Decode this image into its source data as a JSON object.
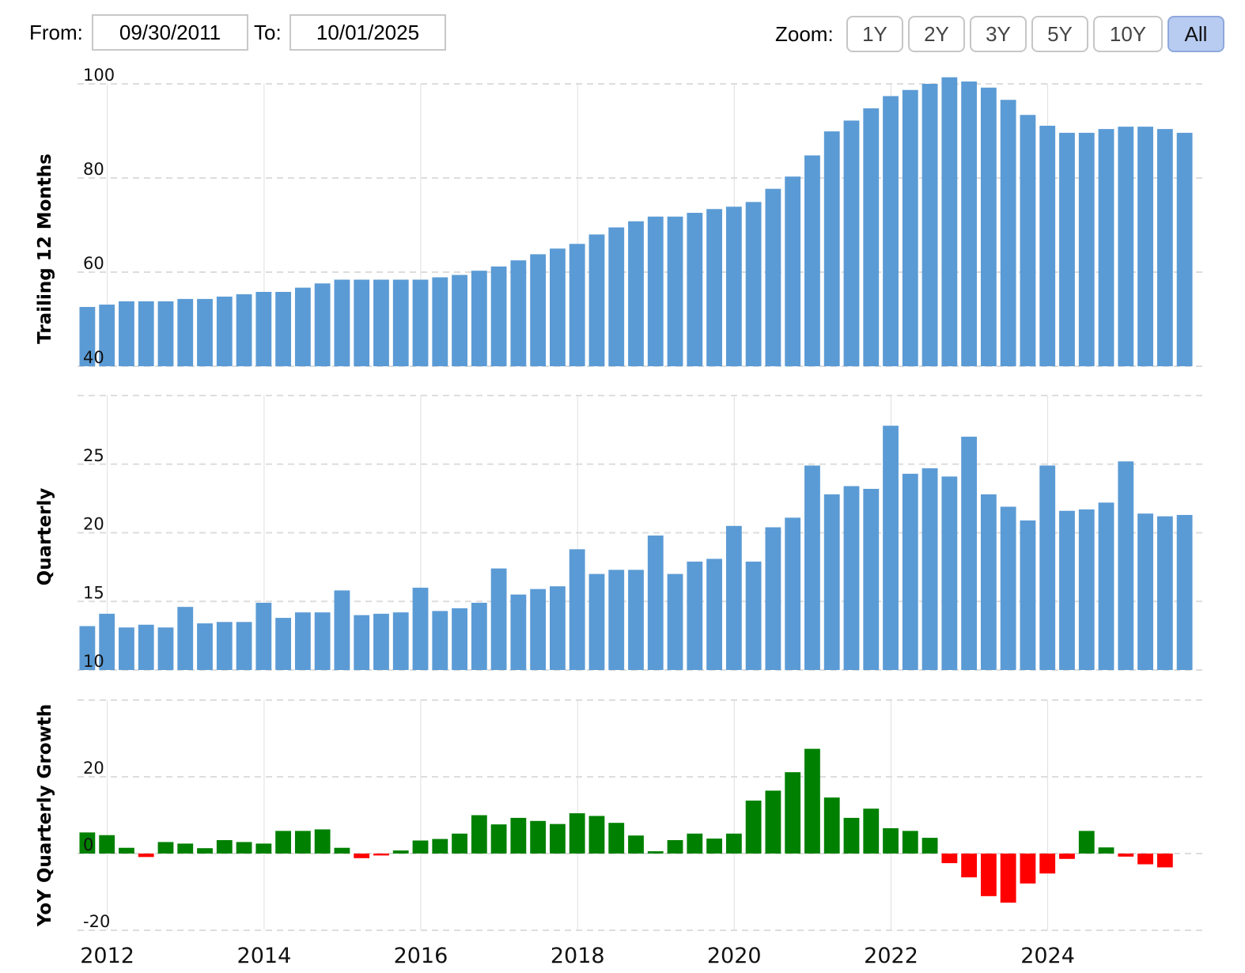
{
  "toolbar": {
    "from_label": "From:",
    "from_value": "09/30/2011",
    "to_label": "To:",
    "to_value": "10/01/2025",
    "zoom_label": "Zoom:",
    "zoom_options": [
      "1Y",
      "2Y",
      "3Y",
      "5Y",
      "10Y",
      "All"
    ],
    "zoom_active": "All"
  },
  "colors": {
    "bar": "#5b9bd5",
    "positive": "#008000",
    "negative": "#ff0000",
    "gridline": "#dddddd"
  },
  "chart_data": [
    {
      "type": "bar",
      "ylabel": "Trailing 12 Months",
      "ylim": [
        40,
        100
      ],
      "yticks": [
        40,
        60,
        80,
        100
      ],
      "x_tick_labels": [
        "2012",
        "2014",
        "2016",
        "2018",
        "2020",
        "2022",
        "2024"
      ],
      "x": [
        "2011-09-30",
        "2011-12-31",
        "2012-03-31",
        "2012-06-30",
        "2012-09-30",
        "2012-12-31",
        "2013-03-31",
        "2013-06-30",
        "2013-09-30",
        "2013-12-31",
        "2014-03-31",
        "2014-06-30",
        "2014-09-30",
        "2014-12-31",
        "2015-03-31",
        "2015-06-30",
        "2015-09-30",
        "2015-12-31",
        "2016-03-31",
        "2016-06-30",
        "2016-09-30",
        "2016-12-31",
        "2017-03-31",
        "2017-06-30",
        "2017-09-30",
        "2017-12-31",
        "2018-03-31",
        "2018-06-30",
        "2018-09-30",
        "2018-12-31",
        "2019-03-31",
        "2019-06-30",
        "2019-09-30",
        "2019-12-31",
        "2020-03-31",
        "2020-06-30",
        "2020-09-30",
        "2020-12-31",
        "2021-03-31",
        "2021-06-30",
        "2021-09-30",
        "2021-12-31",
        "2022-03-31",
        "2022-06-30",
        "2022-09-30",
        "2022-12-31",
        "2023-03-31",
        "2023-06-30",
        "2023-09-30",
        "2023-12-31",
        "2024-03-31",
        "2024-06-30",
        "2024-09-30",
        "2024-12-31",
        "2025-03-31",
        "2025-06-30",
        "2025-09-30"
      ],
      "values": [
        52.6,
        53.1,
        53.8,
        53.8,
        53.8,
        54.3,
        54.3,
        54.8,
        55.3,
        55.8,
        55.8,
        56.7,
        57.6,
        58.4,
        58.4,
        58.4,
        58.4,
        58.4,
        58.9,
        59.4,
        60.3,
        61.2,
        62.5,
        63.8,
        65.0,
        66.0,
        68.0,
        69.5,
        70.8,
        71.8,
        71.8,
        72.6,
        73.4,
        73.9,
        74.9,
        77.7,
        80.3,
        84.8,
        89.9,
        92.2,
        94.8,
        97.4,
        98.7,
        100.0,
        101.4,
        100.5,
        99.2,
        96.6,
        93.4,
        91.1,
        89.6,
        89.6,
        90.4,
        90.9,
        90.9,
        90.4,
        89.6
      ]
    },
    {
      "type": "bar",
      "ylabel": "Quarterly",
      "ylim": [
        10,
        30
      ],
      "yticks": [
        10,
        15,
        20,
        25
      ],
      "x_tick_labels": [
        "2012",
        "2014",
        "2016",
        "2018",
        "2020",
        "2022",
        "2024"
      ],
      "x": [
        "2011-09-30",
        "2011-12-31",
        "2012-03-31",
        "2012-06-30",
        "2012-09-30",
        "2012-12-31",
        "2013-03-31",
        "2013-06-30",
        "2013-09-30",
        "2013-12-31",
        "2014-03-31",
        "2014-06-30",
        "2014-09-30",
        "2014-12-31",
        "2015-03-31",
        "2015-06-30",
        "2015-09-30",
        "2015-12-31",
        "2016-03-31",
        "2016-06-30",
        "2016-09-30",
        "2016-12-31",
        "2017-03-31",
        "2017-06-30",
        "2017-09-30",
        "2017-12-31",
        "2018-03-31",
        "2018-06-30",
        "2018-09-30",
        "2018-12-31",
        "2019-03-31",
        "2019-06-30",
        "2019-09-30",
        "2019-12-31",
        "2020-03-31",
        "2020-06-30",
        "2020-09-30",
        "2020-12-31",
        "2021-03-31",
        "2021-06-30",
        "2021-09-30",
        "2021-12-31",
        "2022-03-31",
        "2022-06-30",
        "2022-09-30",
        "2022-12-31",
        "2023-03-31",
        "2023-06-30",
        "2023-09-30",
        "2023-12-31",
        "2024-03-31",
        "2024-06-30",
        "2024-09-30",
        "2024-12-31",
        "2025-03-31",
        "2025-06-30",
        "2025-09-30"
      ],
      "values": [
        13.2,
        14.1,
        13.1,
        13.3,
        13.1,
        14.6,
        13.4,
        13.5,
        13.5,
        14.9,
        13.8,
        14.2,
        14.2,
        15.8,
        14.0,
        14.1,
        14.2,
        16.0,
        14.3,
        14.5,
        14.9,
        17.4,
        15.5,
        15.9,
        16.1,
        18.8,
        17.0,
        17.3,
        17.3,
        19.8,
        17.0,
        17.9,
        18.1,
        20.5,
        17.9,
        20.4,
        21.1,
        24.9,
        22.8,
        23.4,
        23.2,
        27.8,
        24.3,
        24.7,
        24.1,
        27.0,
        22.8,
        21.9,
        20.9,
        24.9,
        21.6,
        21.7,
        22.2,
        25.2,
        21.4,
        21.2,
        21.3
      ]
    },
    {
      "type": "bar",
      "ylabel": "YoY Quarterly Growth",
      "ylim": [
        -20,
        40
      ],
      "yticks": [
        -20,
        0,
        20
      ],
      "x_tick_labels": [
        "2012",
        "2014",
        "2016",
        "2018",
        "2020",
        "2022",
        "2024"
      ],
      "x": [
        "2011-09-30",
        "2011-12-31",
        "2012-03-31",
        "2012-06-30",
        "2012-09-30",
        "2012-12-31",
        "2013-03-31",
        "2013-06-30",
        "2013-09-30",
        "2013-12-31",
        "2014-03-31",
        "2014-06-30",
        "2014-09-30",
        "2014-12-31",
        "2015-03-31",
        "2015-06-30",
        "2015-09-30",
        "2015-12-31",
        "2016-03-31",
        "2016-06-30",
        "2016-09-30",
        "2016-12-31",
        "2017-03-31",
        "2017-06-30",
        "2017-09-30",
        "2017-12-31",
        "2018-03-31",
        "2018-06-30",
        "2018-09-30",
        "2018-12-31",
        "2019-03-31",
        "2019-06-30",
        "2019-09-30",
        "2019-12-31",
        "2020-03-31",
        "2020-06-30",
        "2020-09-30",
        "2020-12-31",
        "2021-03-31",
        "2021-06-30",
        "2021-09-30",
        "2021-12-31",
        "2022-03-31",
        "2022-06-30",
        "2022-09-30",
        "2022-12-31",
        "2023-03-31",
        "2023-06-30",
        "2023-09-30",
        "2023-12-31",
        "2024-03-31",
        "2024-06-30",
        "2024-09-30",
        "2024-12-31",
        "2025-03-31",
        "2025-06-30",
        "2025-09-30"
      ],
      "values": [
        5.5,
        4.8,
        1.5,
        -0.9,
        3.0,
        2.6,
        1.4,
        3.5,
        3.0,
        2.6,
        5.9,
        5.9,
        6.3,
        1.5,
        -1.2,
        -0.5,
        0.8,
        3.4,
        3.8,
        5.2,
        10.0,
        7.6,
        9.3,
        8.5,
        7.7,
        10.5,
        9.8,
        8.0,
        4.7,
        0.6,
        3.5,
        5.2,
        3.9,
        5.2,
        13.8,
        16.4,
        21.2,
        27.3,
        14.6,
        9.3,
        11.7,
        6.6,
        5.9,
        4.1,
        -2.5,
        -6.2,
        -11.1,
        -12.8,
        -7.8,
        -5.2,
        -1.4,
        5.9,
        1.6,
        -0.8,
        -2.8,
        -3.6,
        0
      ]
    }
  ]
}
